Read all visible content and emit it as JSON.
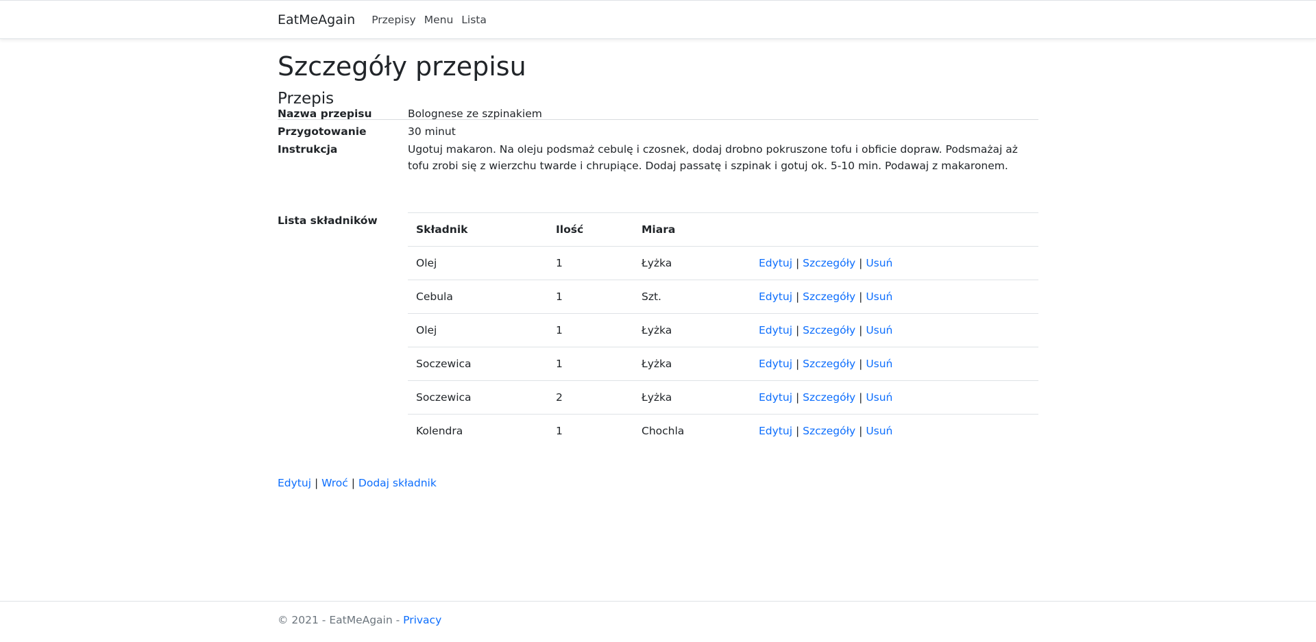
{
  "nav": {
    "brand": "EatMeAgain",
    "links": [
      "Przepisy",
      "Menu",
      "Lista"
    ]
  },
  "page": {
    "title": "Szczegóły przepisu",
    "subtitle": "Przepis"
  },
  "details": {
    "name_label": "Nazwa przepisu",
    "name_value": "Bolognese ze szpinakiem",
    "prep_label": "Przygotowanie",
    "prep_value": "30 minut",
    "instr_label": "Instrukcja",
    "instr_value": "Ugotuj makaron. Na oleju podsmaż cebulę i czosnek, dodaj drobno pokruszone tofu i obficie dopraw. Podsmażaj aż tofu zrobi się z wierzchu twarde i chrupiące. Dodaj passatę i szpinak i gotuj ok. 5-10 min. Podawaj z makaronem.",
    "list_label": "Lista składników"
  },
  "table": {
    "headers": [
      "Składnik",
      "Ilość",
      "Miara"
    ],
    "rows": [
      {
        "ingredient": "Olej",
        "qty": "1",
        "unit": "Łyżka"
      },
      {
        "ingredient": "Cebula",
        "qty": "1",
        "unit": "Szt."
      },
      {
        "ingredient": "Olej",
        "qty": "1",
        "unit": "Łyżka"
      },
      {
        "ingredient": "Soczewica",
        "qty": "1",
        "unit": "Łyżka"
      },
      {
        "ingredient": "Soczewica",
        "qty": "2",
        "unit": "Łyżka"
      },
      {
        "ingredient": "Kolendra",
        "qty": "1",
        "unit": "Chochla"
      }
    ],
    "actions": {
      "edit": "Edytuj",
      "details": "Szczegóły",
      "delete": "Usuń",
      "separator": "|"
    }
  },
  "bottom_links": {
    "edit": "Edytuj",
    "back": "Wroć",
    "add_ingredient": "Dodaj składnik",
    "separator": "|"
  },
  "footer": {
    "copyright": "© 2021 - EatMeAgain - ",
    "privacy": "Privacy"
  },
  "colors": {
    "link": "#0d6efd",
    "text": "#212529",
    "muted": "#6c757d",
    "border": "#dee2e6"
  }
}
